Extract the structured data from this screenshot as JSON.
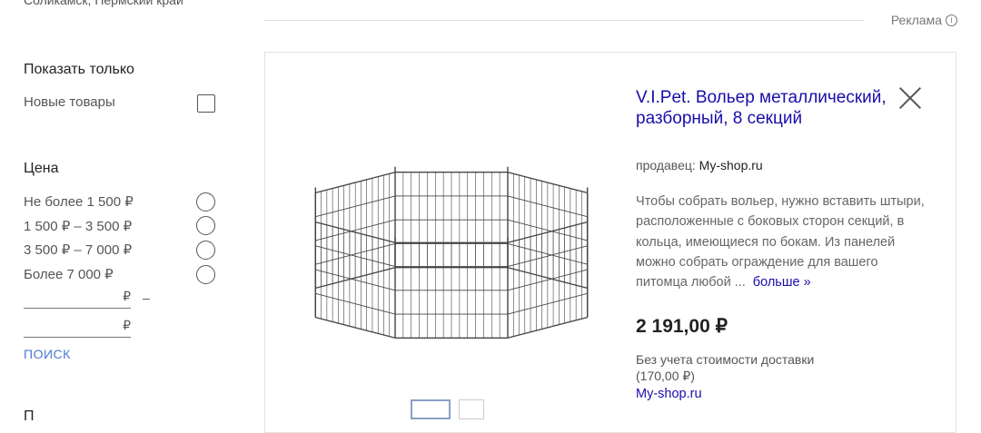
{
  "location": "Соликамск, Пермский край",
  "ad_label": "Реклама",
  "ad_info_icon": "info-icon",
  "filters": {
    "show_only_heading": "Показать только",
    "new_items_label": "Новые товары",
    "price_heading": "Цена",
    "price_options": [
      "Не более 1 500 ₽",
      "1 500 ₽ – 3 500 ₽",
      "3 500 ₽ – 7 000 ₽",
      "Более 7 000 ₽"
    ],
    "currency": "₽",
    "range_separator": "–",
    "search_label": "ПОИСК",
    "next_heading": "П"
  },
  "product": {
    "title": "V.I.Pet. Вольер металлический, разборный, 8 секций",
    "seller_prefix": "продавец:",
    "seller_name": "My-shop.ru",
    "description": "Чтобы собрать вольер, нужно вставить штыри, расположенные с боковых сторон секций, в кольца, имеющиеся по бокам. Из панелей можно собрать ограждение для вашего питомца любой ...",
    "more_label": "больше »",
    "price": "2 191,00 ₽",
    "delivery_note": "Без учета стоимости доставки (170,00 ₽)",
    "shop_link": "My-shop.ru"
  }
}
